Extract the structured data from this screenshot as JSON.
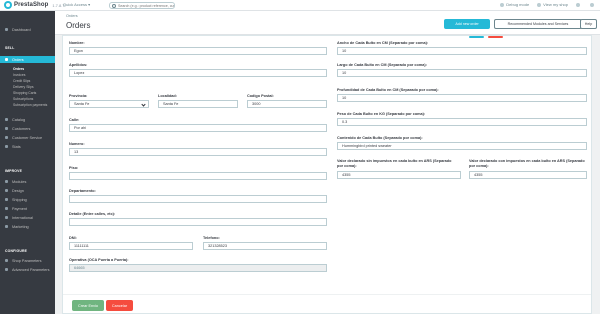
{
  "topbar": {
    "brand": "PrestaShop",
    "version": "1.7.8.7",
    "quick_access": "Quick Access ▾",
    "search_placeholder": "Search (e.g.: product reference, custo",
    "debug_mode": "Debug mode",
    "view_shop": "View my shop",
    "icon_color_accent": "#25b9d7"
  },
  "sidebar": {
    "dashboard": "Dashboard",
    "section_sell": "SELL",
    "orders": "Orders",
    "orders_sub": [
      "Orders",
      "Invoices",
      "Credit Slips",
      "Delivery Slips",
      "Shopping Carts",
      "Subscriptions",
      "Subscription payments"
    ],
    "catalog": "Catalog",
    "customers": "Customers",
    "customer_service": "Customer Service",
    "stats": "Stats",
    "section_improve": "IMPROVE",
    "modules": "Modules",
    "design": "Design",
    "shipping": "Shipping",
    "payment": "Payment",
    "international": "International",
    "marketing": "Marketing",
    "section_configure": "CONFIGURE",
    "shop_parameters": "Shop Parameters",
    "advanced_parameters": "Advanced Parameters"
  },
  "header": {
    "breadcrumb": "Orders",
    "title": "Orders",
    "add_order": "Add new order",
    "recommended": "Recommended Modules and Services",
    "help": "Help"
  },
  "form": {
    "nombre_label": "Nombre:",
    "nombre_value": "Egon",
    "apellidos_label": "Apellidos:",
    "apellidos_value": "Lopez",
    "provincia_label": "Provincia:",
    "provincia_value": "Santa Fe",
    "localidad_label": "Localidad:",
    "localidad_value": "Santa Fe",
    "cp_label": "Codigo Postal:",
    "cp_value": "3000",
    "calle_label": "Calle:",
    "calle_value": "Por ahi",
    "numero_label": "Numero:",
    "numero_value": "13",
    "piso_label": "Piso:",
    "piso_value": "",
    "depto_label": "Departamento:",
    "depto_value": "",
    "detalle_label": "Detalle (Entre calles, etc):",
    "detalle_value": "",
    "dni_label": "DNI:",
    "dni_value": "11111111",
    "telefono_label": "Telefono:",
    "telefono_value": "321328523",
    "operativa_label": "Operativa (OCA Puerta a Puerta):",
    "operativa_value": "64665",
    "ancho_label": "Ancho de Cada Bulto en CM (Separado por coma):",
    "ancho_value": "10",
    "largo_label": "Largo de Cada Bulto en CM (Separado por coma):",
    "largo_value": "10",
    "prof_label": "Profundidad de Cada Bulto en CM (Separado por coma):",
    "prof_value": "10",
    "peso_label": "Peso de Cada Bulto en KG (Separado por coma):",
    "peso_value": "0.3",
    "contenido_label": "Contenido de Cada Bulto (Separado por coma):",
    "contenido_value": "Hummingbird printed sweater",
    "sin_imp_label": "Valor declarado sin impuestos en cada bulto en ARS (Separado por coma):",
    "sin_imp_value": "4355",
    "con_imp_label": "Valor declarado con impuestos en cada bulto en ARS (Separado por coma):",
    "con_imp_value": "4355",
    "save": "Crear Envio",
    "cancel": "Cancelar"
  }
}
